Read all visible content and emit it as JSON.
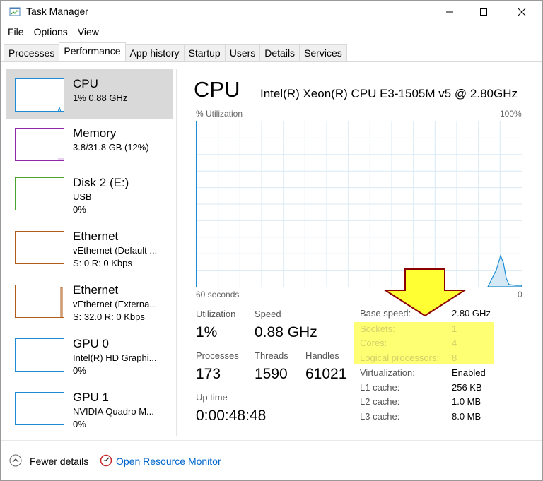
{
  "window": {
    "title": "Task Manager"
  },
  "menu": [
    "File",
    "Options",
    "View"
  ],
  "tabs": [
    "Processes",
    "Performance",
    "App history",
    "Startup",
    "Users",
    "Details",
    "Services"
  ],
  "active_tab": "Performance",
  "sidebar": {
    "items": [
      {
        "title": "CPU",
        "line1": "1% 0.88 GHz",
        "line2": "",
        "color": "#1e8cd2",
        "selected": true
      },
      {
        "title": "Memory",
        "line1": "3.8/31.8 GB (12%)",
        "line2": "",
        "color": "#8e2aa8",
        "selected": false
      },
      {
        "title": "Disk 2 (E:)",
        "line1": "USB",
        "line2": "0%",
        "color": "#4aa32a",
        "selected": false
      },
      {
        "title": "Ethernet",
        "line1": "vEthernet (Default ...",
        "line2": "S: 0 R: 0 Kbps",
        "color": "#b25b19",
        "selected": false
      },
      {
        "title": "Ethernet",
        "line1": "vEthernet (Externa...",
        "line2": "S: 32.0 R: 0 Kbps",
        "color": "#b25b19",
        "selected": false
      },
      {
        "title": "GPU 0",
        "line1": "Intel(R) HD Graphi...",
        "line2": "0%",
        "color": "#1e8cd2",
        "selected": false
      },
      {
        "title": "GPU 1",
        "line1": "NVIDIA Quadro M...",
        "line2": "0%",
        "color": "#1e8cd2",
        "selected": false
      }
    ]
  },
  "main": {
    "title": "CPU",
    "processor": "Intel(R) Xeon(R) CPU E3-1505M v5 @ 2.80GHz",
    "graph": {
      "y_label": "% Utilization",
      "y_max": "100%",
      "x_left": "60 seconds",
      "x_right": "0",
      "color": "#1e8cd2"
    },
    "stats": {
      "utilization_label": "Utilization",
      "utilization": "1%",
      "speed_label": "Speed",
      "speed": "0.88 GHz",
      "processes_label": "Processes",
      "processes": "173",
      "threads_label": "Threads",
      "threads": "1590",
      "handles_label": "Handles",
      "handles": "61021",
      "uptime_label": "Up time",
      "uptime": "0:00:48:48"
    },
    "info": [
      {
        "label": "Base speed:",
        "value": "2.80 GHz"
      },
      {
        "label": "Sockets:",
        "value": "1"
      },
      {
        "label": "Cores:",
        "value": "4"
      },
      {
        "label": "Logical processors:",
        "value": "8"
      },
      {
        "label": "Virtualization:",
        "value": "Enabled"
      },
      {
        "label": "L1 cache:",
        "value": "256 KB"
      },
      {
        "label": "L2 cache:",
        "value": "1.0 MB"
      },
      {
        "label": "L3 cache:",
        "value": "8.0 MB"
      }
    ]
  },
  "footer": {
    "fewer_details": "Fewer details",
    "resource_monitor": "Open Resource Monitor"
  },
  "annotation": {
    "arrow_color": "#ffff33",
    "arrow_stroke": "#8b0000",
    "highlight_color": "#ffff5a"
  }
}
